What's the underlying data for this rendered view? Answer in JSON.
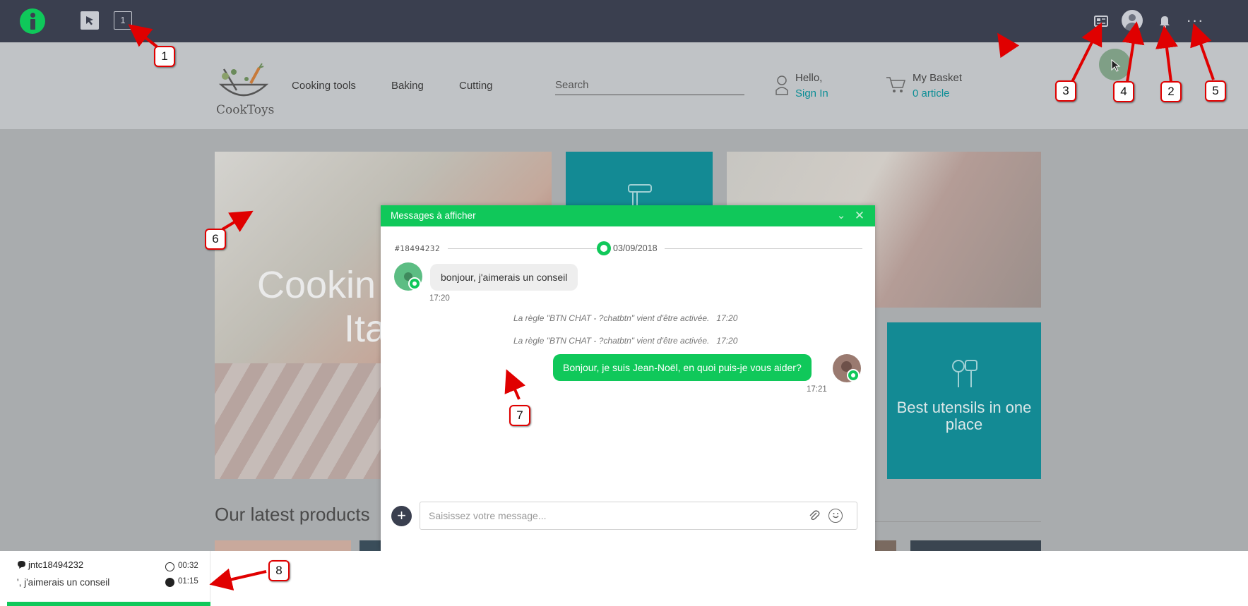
{
  "toolbar": {
    "cursor_icon": "cursor-arrow-icon",
    "count_label": "1",
    "icons": [
      "id-card-icon",
      "user-avatar-icon",
      "bell-icon",
      "more-dots-icon"
    ],
    "more_label": "···"
  },
  "site": {
    "brand": "CookToys",
    "nav": [
      "Cooking tools",
      "Baking",
      "Cutting"
    ],
    "search_placeholder": "Search",
    "hello": "Hello,",
    "signin": "Sign In",
    "basket": "My Basket",
    "basket_count": "0 article",
    "hero_line1": "Cookin",
    "hero_line2": "Ita",
    "tile_text": "Best utensils in one place",
    "latest": "Our latest products"
  },
  "chat": {
    "title": "Messages à afficher",
    "conversation_id": "#18494232",
    "date": "03/09/2018",
    "messages": [
      {
        "from": "client",
        "text": "bonjour, j'aimerais un conseil",
        "time": "17:20"
      },
      {
        "from": "system",
        "text": "La règle \"BTN CHAT - ?chatbtn\" vient d'être activée.",
        "time": "17:20"
      },
      {
        "from": "system",
        "text": "La règle \"BTN CHAT - ?chatbtn\" vient d'être activée.",
        "time": "17:20"
      },
      {
        "from": "agent",
        "text": "Bonjour, je suis Jean-Noël, en quoi puis-je vous aider?",
        "time": "17:21"
      }
    ],
    "input_placeholder": "Saisissez votre message...",
    "plus_label": "+"
  },
  "ticket": {
    "id": "jntc18494232",
    "last_message": "', j'aimerais un conseil",
    "timer_1": "00:32",
    "timer_2": "01:15"
  },
  "annotations": [
    "1",
    "2",
    "3",
    "4",
    "5",
    "6",
    "7",
    "8"
  ],
  "colors": {
    "accent": "#10c85a",
    "teal": "#138a94",
    "toolbar": "#3a3f4f",
    "annotation": "#e00000"
  }
}
